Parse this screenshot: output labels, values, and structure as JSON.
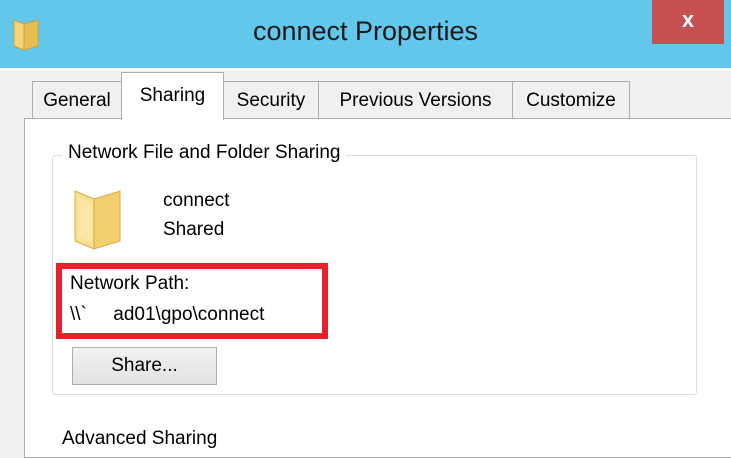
{
  "window": {
    "title": "connect Properties",
    "close_label": "x"
  },
  "tabs": [
    {
      "label": "General",
      "active": false
    },
    {
      "label": "Sharing",
      "active": true
    },
    {
      "label": "Security",
      "active": false
    },
    {
      "label": "Previous Versions",
      "active": false
    },
    {
      "label": "Customize",
      "active": false
    }
  ],
  "sharing": {
    "group_title": "Network File and Folder Sharing",
    "folder_name": "connect",
    "folder_status": "Shared",
    "network_path_label": "Network Path:",
    "network_path_value": "\\\\`     ad01\\gpo\\connect",
    "share_button_label": "Share...",
    "advanced_group_title": "Advanced Sharing"
  },
  "colors": {
    "titlebar": "#62c7ea",
    "close_button": "#c75050",
    "highlight": "#e5222a",
    "folder": "#f3d77a"
  },
  "icons": {
    "title_icon": "folder-icon",
    "large_icon": "folder-icon"
  }
}
